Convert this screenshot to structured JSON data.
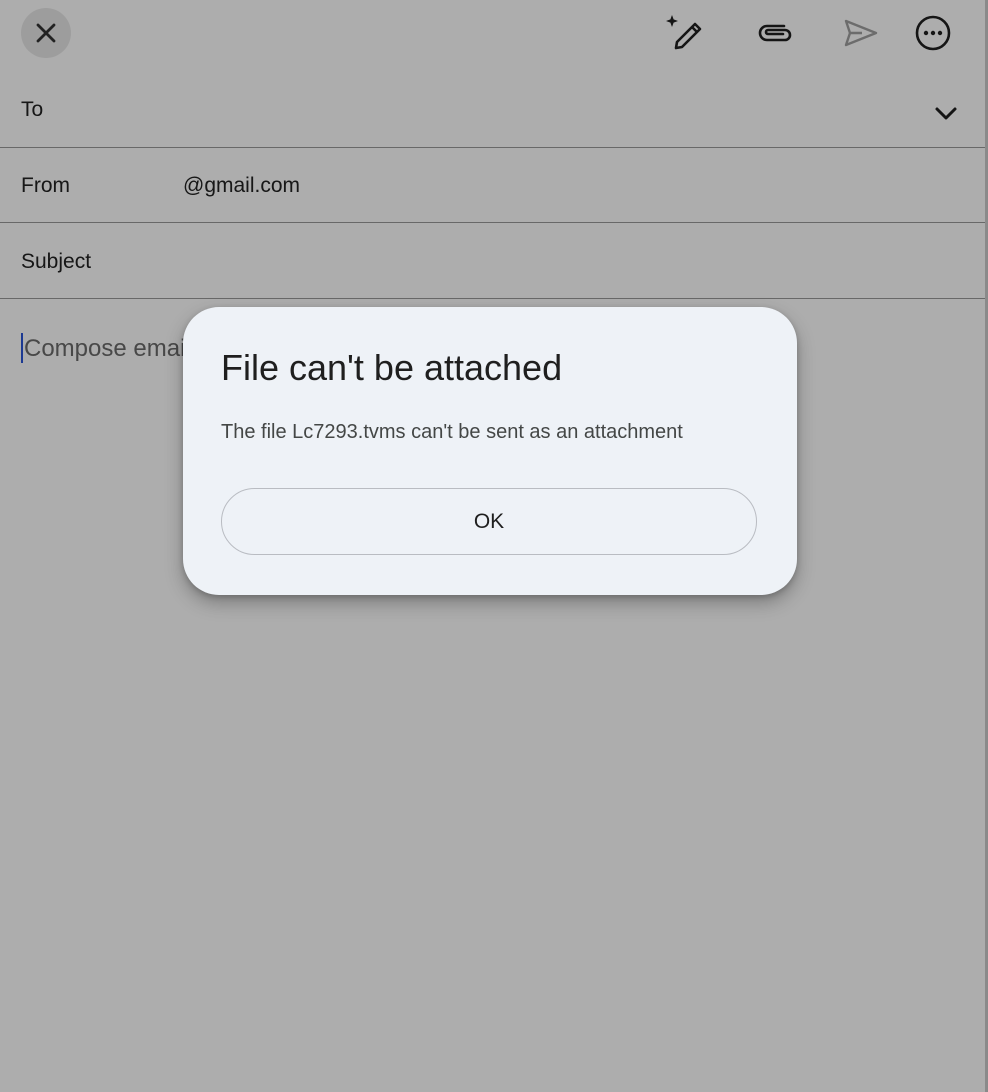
{
  "compose": {
    "to_label": "To",
    "from_label": "From",
    "from_value": "@gmail.com",
    "subject_label": "Subject",
    "body_placeholder": "Compose email"
  },
  "toolbar": {
    "icons": [
      "close-icon",
      "magic-pen-icon",
      "attachment-icon",
      "send-icon",
      "more-options-icon"
    ]
  },
  "dialog": {
    "title": "File can't be attached",
    "message": "The file Lc7293.tvms can't be sent as an attachment",
    "ok_label": "OK"
  },
  "colors": {
    "caret": "#2a55d8",
    "dialog_bg": "#eef2f7",
    "scrim": "rgba(0,0,0,0.32)"
  }
}
